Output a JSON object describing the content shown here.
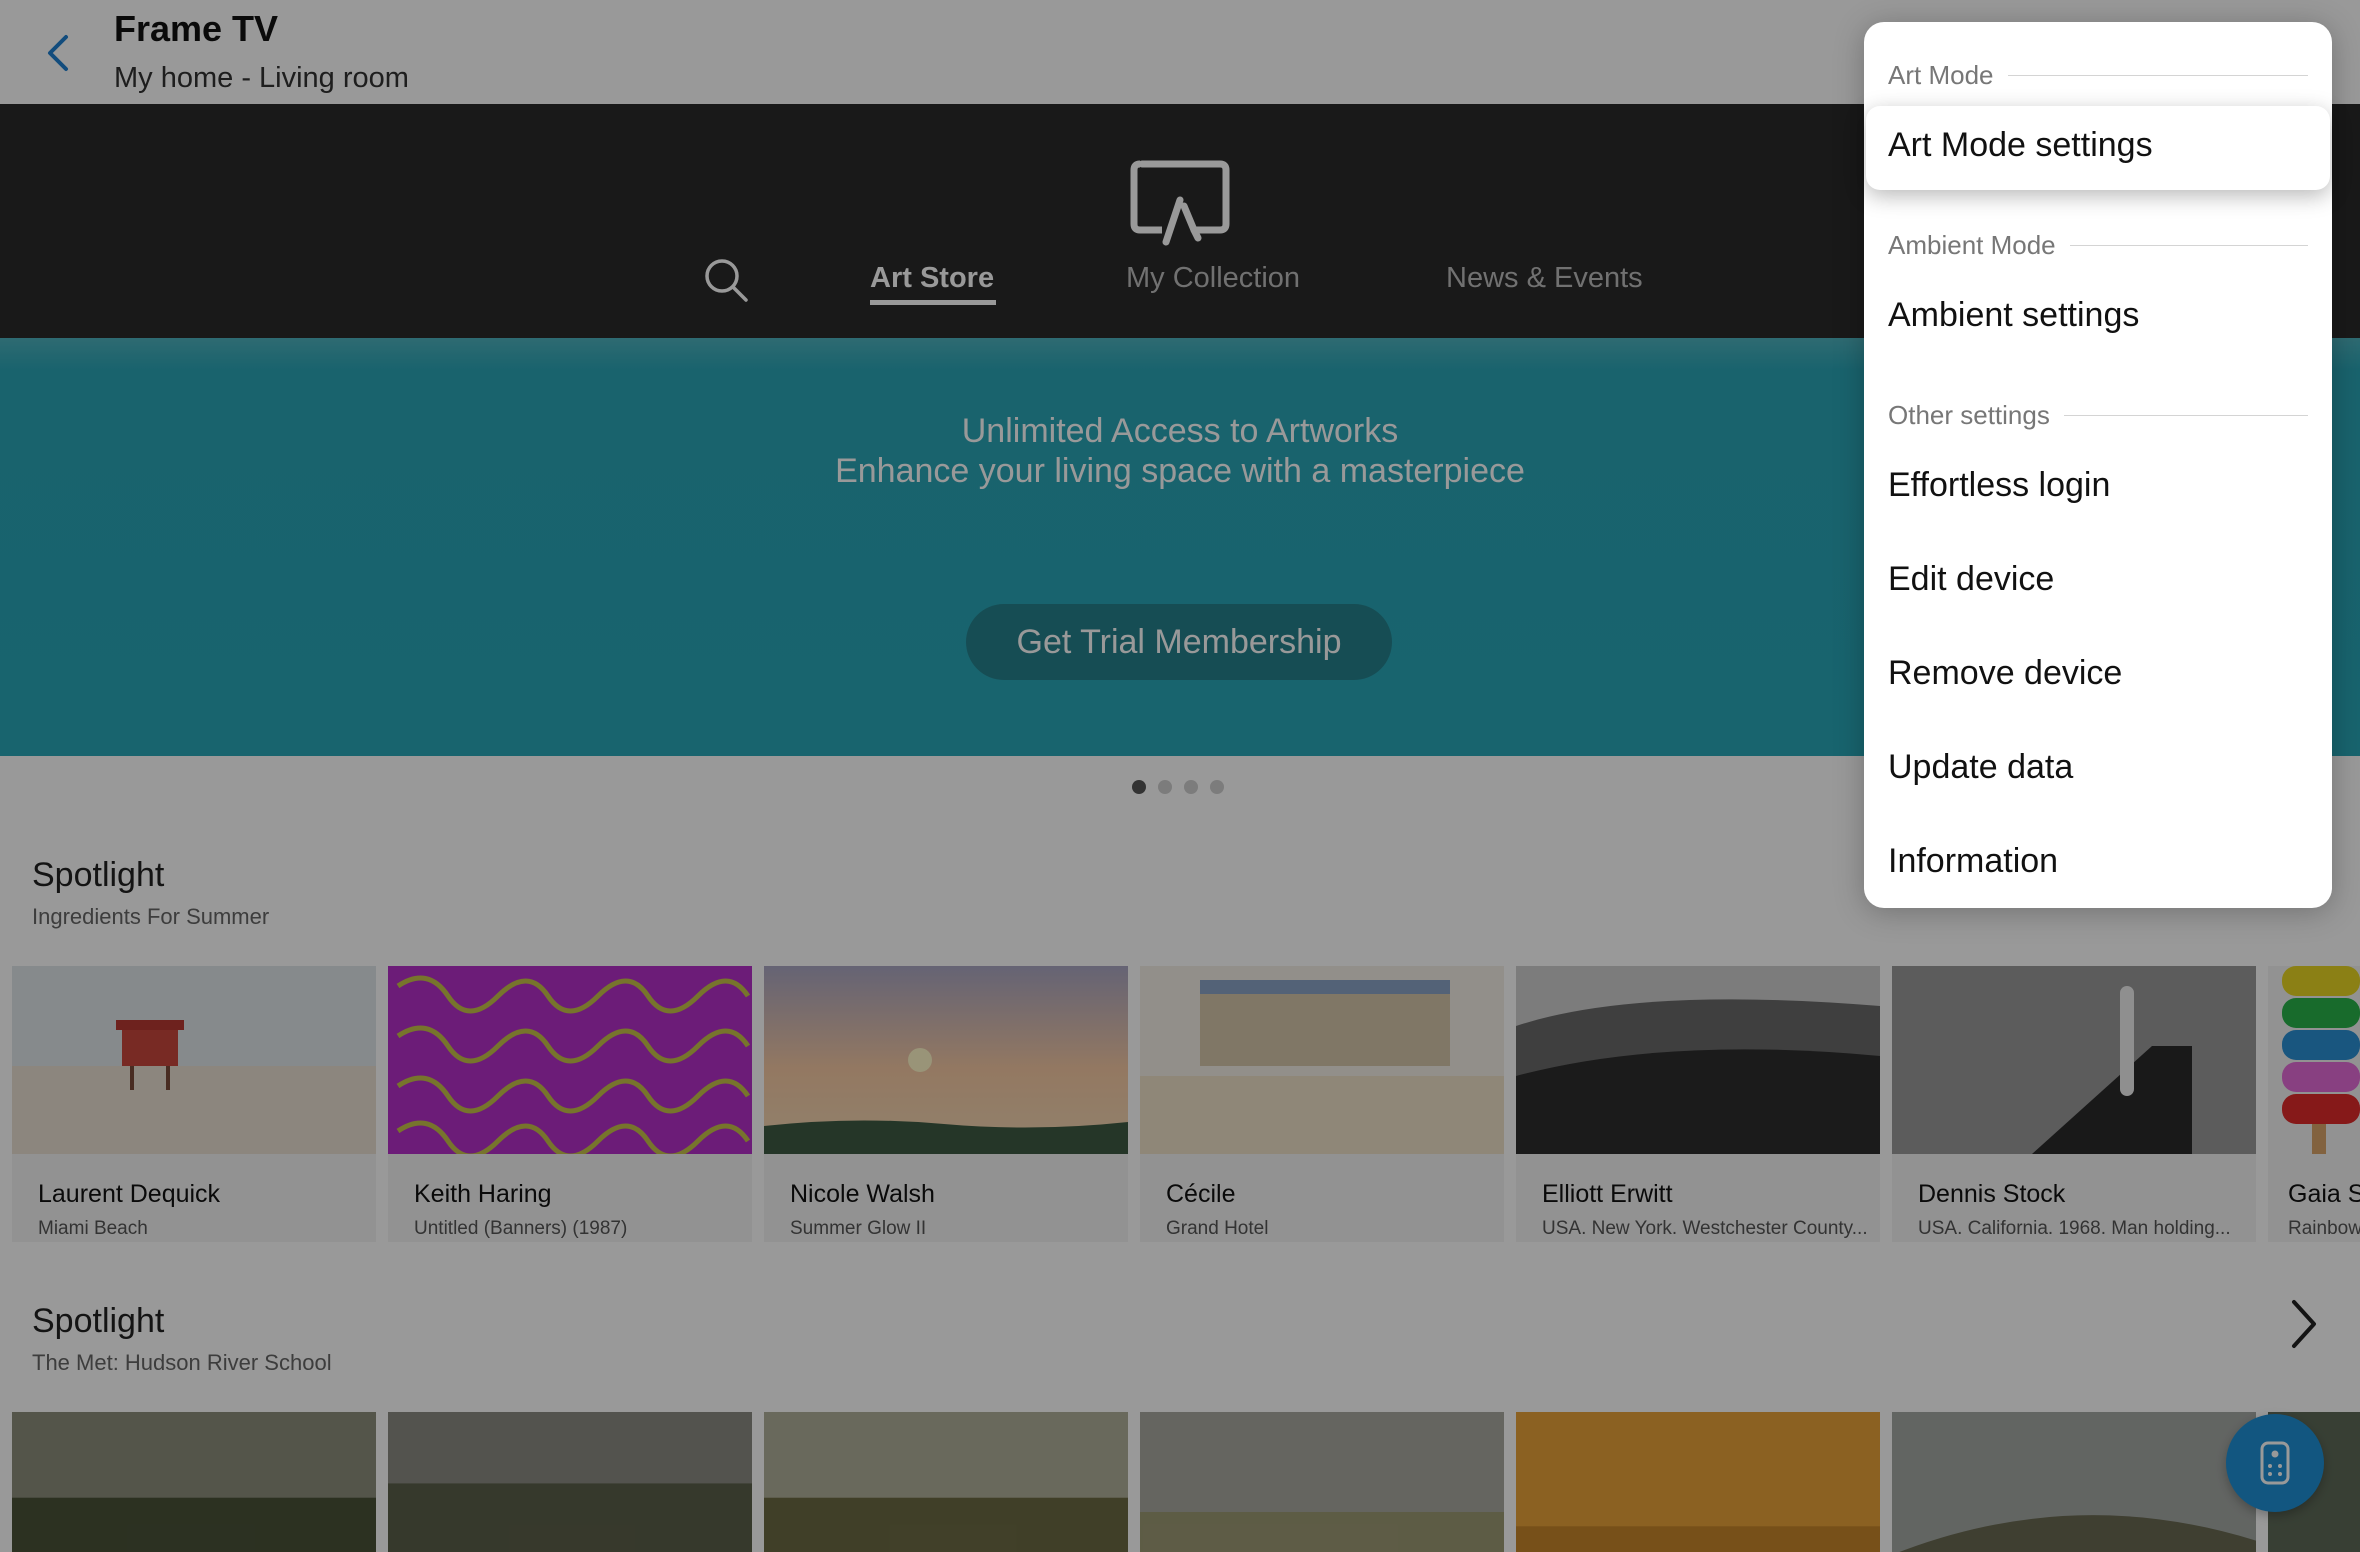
{
  "header": {
    "title": "Frame TV",
    "subtitle": "My home - Living room"
  },
  "store_nav": {
    "tabs": [
      {
        "label": "Art Store",
        "active": true
      },
      {
        "label": "My Collection",
        "active": false
      },
      {
        "label": "News & Events",
        "active": false
      }
    ]
  },
  "banner": {
    "title": "Unlimited Access to Artworks",
    "subtitle": "Enhance your living space with a masterpiece",
    "button_label": "Get Trial Membership",
    "page_count": 4,
    "current_page": 1
  },
  "sections": [
    {
      "title": "Spotlight",
      "subtitle": "Ingredients For Summer",
      "items": [
        {
          "artist": "Laurent Dequick",
          "artwork": "Miami Beach"
        },
        {
          "artist": "Keith Haring",
          "artwork": "Untitled (Banners) (1987)"
        },
        {
          "artist": "Nicole Walsh",
          "artwork": "Summer Glow II"
        },
        {
          "artist": "Cécile",
          "artwork": "Grand Hotel"
        },
        {
          "artist": "Elliott Erwitt",
          "artwork": "USA. New York. Westchester County..."
        },
        {
          "artist": "Dennis Stock",
          "artwork": "USA. California. 1968. Man holding..."
        },
        {
          "artist": "Gaia S",
          "artwork": "Rainbow"
        }
      ]
    },
    {
      "title": "Spotlight",
      "subtitle": "The Met: Hudson River School"
    }
  ],
  "menu": {
    "groups": [
      {
        "header": "Art Mode",
        "items": [
          "Art Mode settings"
        ]
      },
      {
        "header": "Ambient Mode",
        "items": [
          "Ambient settings"
        ]
      },
      {
        "header": "Other settings",
        "items": [
          "Effortless login",
          "Edit device",
          "Remove device",
          "Update data",
          "Information"
        ]
      }
    ],
    "focused_item": "Art Mode settings"
  },
  "colors": {
    "accent": "#1e8fd6",
    "banner": "#29a7b7",
    "nav_background": "#2a2a2a"
  },
  "icons": [
    "back-chevron-icon",
    "frame-tv-logo-icon",
    "search-icon",
    "chevron-right-icon",
    "remote-control-icon"
  ]
}
